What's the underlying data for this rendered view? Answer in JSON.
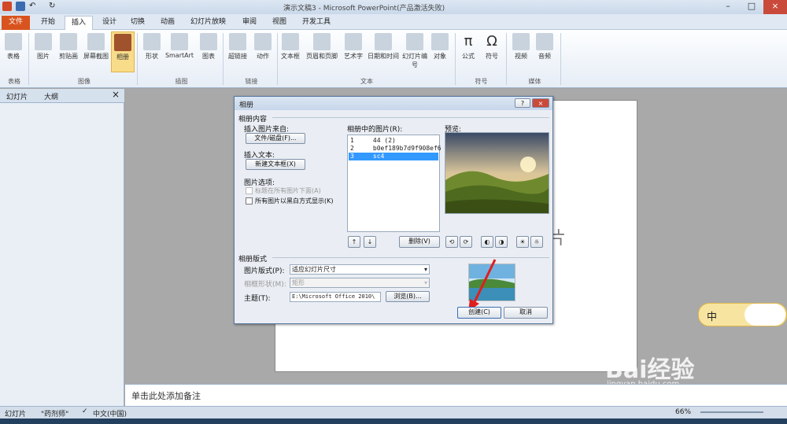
{
  "window": {
    "title": "演示文稿3 - Microsoft PowerPoint(产品激活失败)"
  },
  "tabs": [
    "文件",
    "开始",
    "插入",
    "设计",
    "切换",
    "动画",
    "幻灯片放映",
    "审阅",
    "视图",
    "开发工具"
  ],
  "ribbon": {
    "buttons": [
      "表格",
      "图片",
      "剪贴画",
      "屏幕截图",
      "相册",
      "形状",
      "SmartArt",
      "图表",
      "超链接",
      "动作",
      "文本框",
      "页眉和页脚",
      "艺术字",
      "日期和时间",
      "幻灯片编号",
      "对象",
      "公式",
      "符号",
      "视频",
      "音频"
    ],
    "groups": [
      "表格",
      "图像",
      "插图",
      "链接",
      "文本",
      "符号",
      "媒体"
    ]
  },
  "left_pane": {
    "tab1": "幻灯片",
    "tab2": "大纲",
    "close": "×"
  },
  "notes_placeholder": "单击此处添加备注",
  "dialog": {
    "title": "相册",
    "help": "?",
    "close": "×",
    "section_content": "相册内容",
    "insert_from": "插入图片来自:",
    "file_disk_btn": "文件/磁盘(F)...",
    "insert_text": "插入文本:",
    "new_textbox_btn": "新建文本框(X)",
    "pic_options": "图片选项:",
    "caption_below": "标题在所有图片下面(A)",
    "bw_all": "所有图片以黑白方式显示(K)",
    "list_label": "相册中的图片(R):",
    "list": [
      {
        "num": "1",
        "name": "44 (2)"
      },
      {
        "num": "2",
        "name": "b0ef189b7d9f908ef6"
      },
      {
        "num": "3",
        "name": "sc4"
      }
    ],
    "preview_label": "预览:",
    "up": "↑",
    "down": "↓",
    "remove_btn": "删除(V)",
    "section_layout": "相册版式",
    "layout_label": "图片版式(P):",
    "layout_value": "适应幻灯片尺寸",
    "frame_label": "相框形状(M):",
    "frame_value": "矩形",
    "theme_label": "主题(T):",
    "theme_value": "E:\\Microsoft Office 2010\\",
    "browse_btn": "浏览(B)...",
    "create_btn": "创建(C)",
    "cancel_btn": "取消"
  },
  "statusbar": {
    "slide": "幻灯片",
    "theme": "\"药剂师\"",
    "lang": "中文(中国)",
    "zoom": "66%"
  },
  "ime": {
    "label": "中"
  },
  "watermark": {
    "text": "Bai经验",
    "url": "jingyan.baidu.com"
  },
  "slide_text_fragment": "片"
}
